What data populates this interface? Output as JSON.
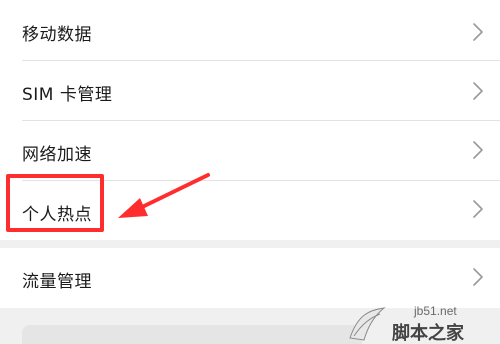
{
  "settings": {
    "items": [
      {
        "label": "移动数据"
      },
      {
        "label": "SIM 卡管理"
      },
      {
        "label": "网络加速"
      },
      {
        "label": "个人热点"
      }
    ],
    "items2": [
      {
        "label": "流量管理"
      }
    ]
  },
  "annotation": {
    "highlight_color": "#ff2d2d",
    "highlighted_item": "个人热点"
  },
  "watermark": {
    "url": "jb51.net",
    "name": "脚本之家"
  },
  "icons": {
    "chevron": "chevron-right-icon"
  }
}
